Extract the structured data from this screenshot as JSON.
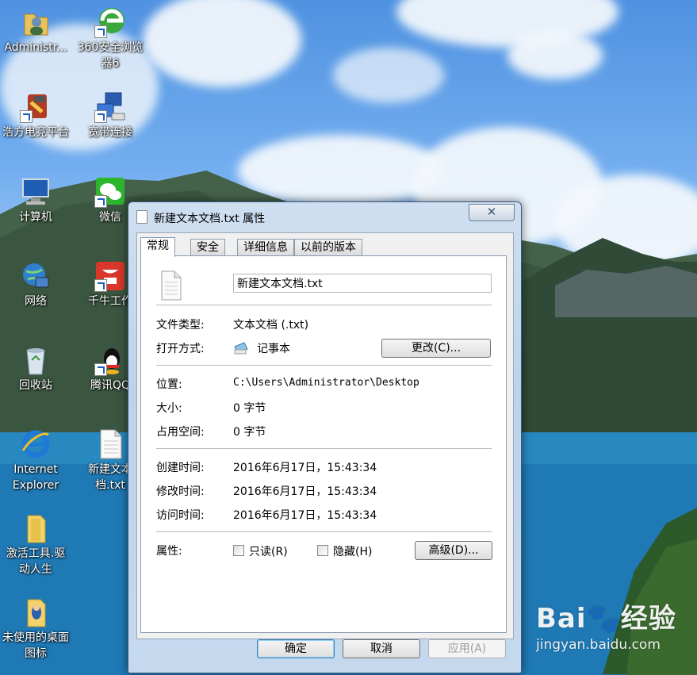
{
  "desktop": {
    "icons": [
      {
        "label": "Administr...",
        "icon": "user-folder-icon"
      },
      {
        "label": "360安全浏览",
        "label2": "器6",
        "icon": "browser-360-icon"
      },
      {
        "label": "浩方电竞平台",
        "icon": "haofang-icon"
      },
      {
        "label": "宽带连接",
        "icon": "broadband-icon"
      },
      {
        "label": "计算机",
        "icon": "computer-icon"
      },
      {
        "label": "微信",
        "icon": "wechat-icon"
      },
      {
        "label": "网络",
        "icon": "network-icon"
      },
      {
        "label": "千牛工作",
        "icon": "qianniu-icon"
      },
      {
        "label": "回收站",
        "icon": "recycle-bin-icon"
      },
      {
        "label": "腾讯QQ",
        "icon": "qq-icon"
      },
      {
        "label": "Internet",
        "label2": "Explorer",
        "icon": "ie-icon"
      },
      {
        "label": "新建文本",
        "label2": "档.txt",
        "icon": "text-file-icon"
      },
      {
        "label": "激活工具.驱",
        "label2": "动人生",
        "icon": "folder-icon"
      },
      {
        "label": "未使用的桌面",
        "label2": "图标",
        "icon": "folder-icon"
      }
    ]
  },
  "dialog": {
    "title": "新建文本文档.txt 属性",
    "close_glyph": "✕",
    "tabs": [
      "常规",
      "安全",
      "详细信息",
      "以前的版本"
    ],
    "active_tab": "常规",
    "file_name": "新建文本文档.txt",
    "file_type_label": "文件类型:",
    "file_type_value": "文本文档 (.txt)",
    "open_with_label": "打开方式:",
    "open_with_value": "记事本",
    "change_button": "更改(C)...",
    "location_label": "位置:",
    "location_value": "C:\\Users\\Administrator\\Desktop",
    "size_label": "大小:",
    "size_value": "0 字节",
    "size_on_disk_label": "占用空间:",
    "size_on_disk_value": "0 字节",
    "created_label": "创建时间:",
    "created_value": "2016年6月17日，15:43:34",
    "modified_label": "修改时间:",
    "modified_value": "2016年6月17日，15:43:34",
    "accessed_label": "访问时间:",
    "accessed_value": "2016年6月17日，15:43:34",
    "attributes_label": "属性:",
    "readonly_label": "只读(R)",
    "readonly_checked": false,
    "hidden_label": "隐藏(H)",
    "hidden_checked": false,
    "advanced_button": "高级(D)...",
    "ok_button": "确定",
    "cancel_button": "取消",
    "apply_button": "应用(A)"
  },
  "watermark": {
    "logo": "Bai🐾经验",
    "url": "jingyan.baidu.com"
  }
}
